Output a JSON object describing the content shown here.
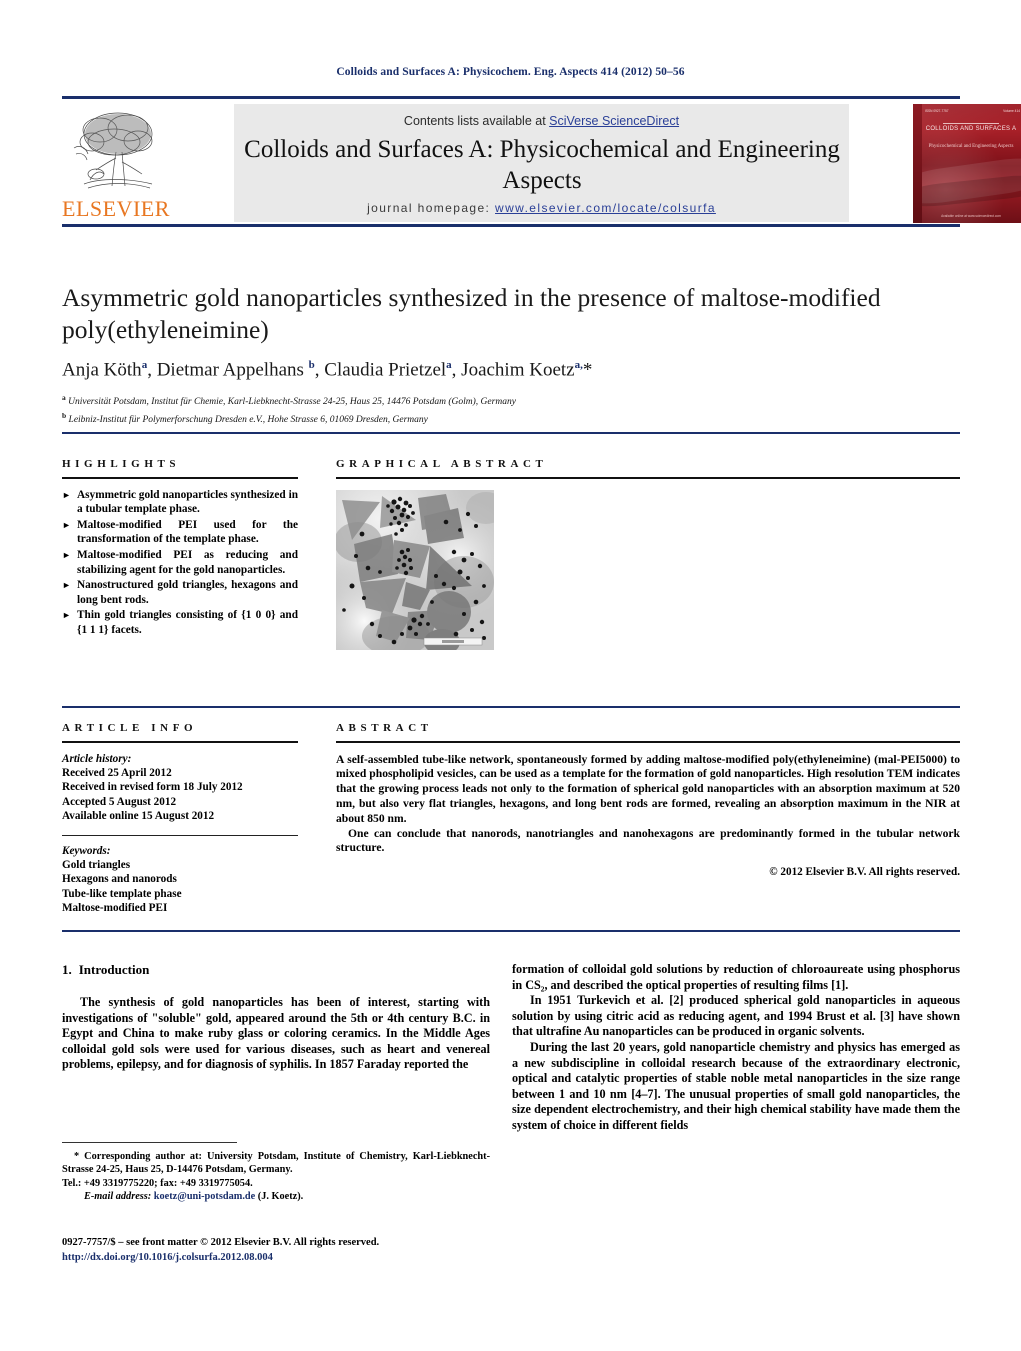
{
  "running_head": "Colloids and Surfaces A: Physicochem. Eng. Aspects 414 (2012) 50–56",
  "masthead": {
    "contents_prefix": "Contents lists available at ",
    "sciencedirect": "SciVerse ScienceDirect",
    "journal_title": "Colloids and Surfaces A: Physicochemical and Engineering Aspects",
    "homepage_label": "journal homepage:",
    "homepage_url": "www.elsevier.com/locate/colsurfa",
    "publisher": "ELSEVIER",
    "cover": {
      "title": "COLLOIDS AND SURFACES A",
      "subtitle": "Physicochemical and Engineering Aspects",
      "top_left": "ISSN 0927-7757",
      "top_right": "Volume 414",
      "bottom": "Available online at www.sciencedirect.com",
      "color": "#8e1520"
    }
  },
  "article": {
    "title": "Asymmetric gold nanoparticles synthesized in the presence of maltose-modified poly(ethyleneimine)",
    "authors": "Anja Köth<sup>a</sup>, Dietmar Appelhans <sup>b</sup>, Claudia Prietzel<sup>a</sup>, Joachim Koetz<sup>a,</sup>*",
    "affiliation_a": "<sup>a</sup> Universität Potsdam, Institut für Chemie, Karl-Liebknecht-Strasse 24-25, Haus 25, 14476 Potsdam (Golm), Germany",
    "affiliation_b": "<sup>b</sup> Leibniz-Institut für Polymerforschung Dresden e.V., Hohe Strasse 6, 01069 Dresden, Germany"
  },
  "sections": {
    "highlights_heading": "HIGHLIGHTS",
    "graphical_abstract_heading": "GRAPHICAL ABSTRACT",
    "article_info_heading": "ARTICLE INFO",
    "abstract_heading": "ABSTRACT"
  },
  "highlights": [
    "Asymmetric gold nanoparticles synthesized in a tubular template phase.",
    "Maltose-modified PEI used for the transformation of the template phase.",
    "Maltose-modified PEI as reducing and stabilizing agent for the gold nanoparticles.",
    "Nanostructured gold triangles, hexagons and long bent rods.",
    "Thin gold triangles consisting of {1 0 0} and {1 1 1} facets."
  ],
  "article_info": {
    "history_label": "Article history:",
    "history": [
      "Received 25 April 2012",
      "Received in revised form 18 July 2012",
      "Accepted 5 August 2012",
      "Available online 15 August 2012"
    ],
    "keywords_label": "Keywords:",
    "keywords": [
      "Gold triangles",
      "Hexagons and nanorods",
      "Tube-like template phase",
      "Maltose-modified PEI"
    ]
  },
  "abstract": {
    "paragraph_1": "A self-assembled tube-like network, spontaneously formed by adding maltose-modified poly(ethyleneimine) (mal-PEI5000) to mixed phospholipid vesicles, can be used as a template for the formation of gold nanoparticles. High resolution TEM indicates that the growing process leads not only to the formation of spherical gold nanoparticles with an absorption maximum at 520 nm, but also very flat triangles, hexagons, and long bent rods are formed, revealing an absorption maximum in the NIR at about 850 nm.",
    "paragraph_2": "One can conclude that nanorods, nanotriangles and nanohexagons are predominantly formed in the tubular network structure.",
    "copyright": "© 2012 Elsevier B.V. All rights reserved."
  },
  "introduction": {
    "section_number": "1.",
    "section_title": "Introduction",
    "left_paragraph": "The synthesis of gold nanoparticles has been of interest, starting with investigations of \"soluble\" gold, appeared around the 5th or 4th century B.C. in Egypt and China to make ruby glass or coloring ceramics. In the Middle Ages colloidal gold sols were used for various diseases, such as heart and venereal problems, epilepsy, and for diagnosis of syphilis. In 1857 Faraday reported the",
    "right_paragraph_1": "formation of colloidal gold solutions by reduction of chloroaureate using phosphorus in CS₂, and described the optical properties of resulting films [1].",
    "right_paragraph_2": "In 1951 Turkevich et al. [2] produced spherical gold nanoparticles in aqueous solution by using citric acid as reducing agent, and 1994 Brust et al. [3] have shown that ultrafine Au nanoparticles can be produced in organic solvents.",
    "right_paragraph_3": "During the last 20 years, gold nanoparticle chemistry and physics has emerged as a new subdiscipline in colloidal research because of the extraordinary electronic, optical and catalytic properties of stable noble metal nanoparticles in the size range between 1 and 10 nm [4–7]. The unusual properties of small gold nanoparticles, the size dependent electrochemistry, and their high chemical stability have made them the system of choice in different fields"
  },
  "footnotes": {
    "corresponding": "* Corresponding author at: University Potsdam, Institute of Chemistry, Karl-Liebknecht-Strasse 24-25, Haus 25, D-14476 Potsdam, Germany.",
    "tel": "Tel.: +49 3319775220; fax: +49 3319775054.",
    "email_label": "E-mail address:",
    "email": "koetz@uni-potsdam.de",
    "email_suffix": "(J. Koetz).",
    "issn_line": "0927-7757/$ – see front matter © 2012 Elsevier B.V. All rights reserved.",
    "doi": "http://dx.doi.org/10.1016/j.colsurfa.2012.08.004"
  },
  "colors": {
    "link": "#2a3f97",
    "rule": "#1a2f6b",
    "elsevier_orange": "#e87722",
    "band_grey": "#e9e9e9"
  }
}
